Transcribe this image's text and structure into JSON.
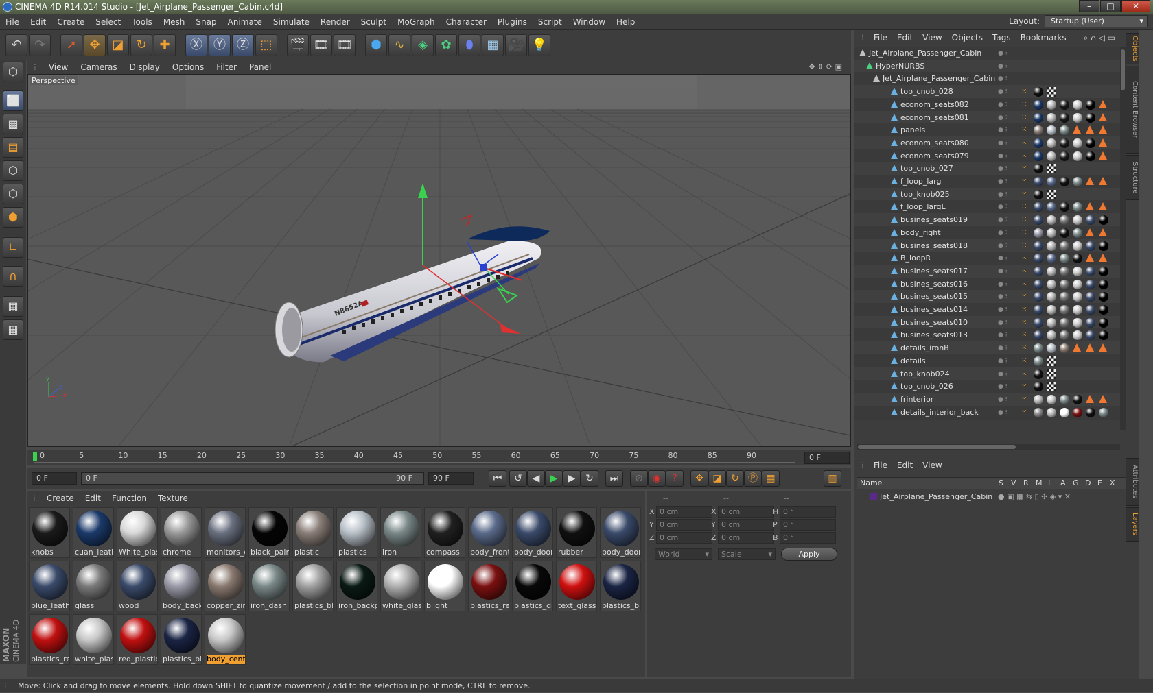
{
  "titlebar": {
    "title": "CINEMA 4D R14.014 Studio - [Jet_Airplane_Passenger_Cabin.c4d]"
  },
  "menu": [
    "File",
    "Edit",
    "Create",
    "Select",
    "Tools",
    "Mesh",
    "Snap",
    "Animate",
    "Simulate",
    "Render",
    "Sculpt",
    "MoGraph",
    "Character",
    "Plugins",
    "Script",
    "Window",
    "Help"
  ],
  "layout": {
    "label": "Layout:",
    "value": "Startup (User)"
  },
  "viewport": {
    "menu": [
      "View",
      "Cameras",
      "Display",
      "Options",
      "Filter",
      "Panel"
    ],
    "label": "Perspective",
    "registration": "N8652A"
  },
  "timeline": {
    "ticks": [
      "0",
      "5",
      "10",
      "15",
      "20",
      "25",
      "30",
      "35",
      "40",
      "45",
      "50",
      "55",
      "60",
      "65",
      "70",
      "75",
      "80",
      "85",
      "90"
    ],
    "frame_field": "0 F",
    "start_field": "0 F",
    "range_start": "0 F",
    "range_end": "90 F",
    "end_field": "90 F"
  },
  "materials": {
    "menu": [
      "Create",
      "Edit",
      "Function",
      "Texture"
    ],
    "items": [
      {
        "name": "knobs",
        "color": "#1a1a1a"
      },
      {
        "name": "cuan_leath",
        "color": "#1b3a6a"
      },
      {
        "name": "White_plas",
        "color": "#d8d8d8"
      },
      {
        "name": "chrome",
        "color": "#9a9a9a"
      },
      {
        "name": "monitors_e",
        "color": "#6a7080"
      },
      {
        "name": "black_pain",
        "color": "#050505"
      },
      {
        "name": "plastic",
        "color": "#8a7e78"
      },
      {
        "name": "plastics",
        "color": "#b8c0c8"
      },
      {
        "name": "iron",
        "color": "#7a8888"
      },
      {
        "name": "compass",
        "color": "#202020"
      },
      {
        "name": "body_front",
        "color": "#5a6a8a"
      },
      {
        "name": "body_door",
        "color": "#3a4a6a"
      },
      {
        "name": "rubber",
        "color": "#101010"
      },
      {
        "name": "body_door",
        "color": "#3a4a6a"
      },
      {
        "name": "blue_leath",
        "color": "#3a4a6a"
      },
      {
        "name": "glass",
        "color": "#7a7a7a"
      },
      {
        "name": "wood",
        "color": "#3a4a6a"
      },
      {
        "name": "body_back",
        "color": "#9a9aa8"
      },
      {
        "name": "copper_zin",
        "color": "#8a7a70"
      },
      {
        "name": "iron_dash",
        "color": "#7a8888"
      },
      {
        "name": "plastics_bl",
        "color": "#a0a0a0"
      },
      {
        "name": "iron_backp",
        "color": "#0a1a14"
      },
      {
        "name": "white_glas",
        "color": "#b0b0b0"
      },
      {
        "name": "blight",
        "color": "#ffffff"
      },
      {
        "name": "plastics_re",
        "color": "#7a1010"
      },
      {
        "name": "plastics_da",
        "color": "#080808"
      },
      {
        "name": "text_glass",
        "color": "#d01010"
      },
      {
        "name": "plastics_bl",
        "color": "#1a2444"
      },
      {
        "name": "plastics_re",
        "color": "#c01010"
      },
      {
        "name": "white_plas",
        "color": "#c8c8c8"
      },
      {
        "name": "red_plastic",
        "color": "#c01010"
      },
      {
        "name": "plastics_bl",
        "color": "#1a2444"
      },
      {
        "name": "body_cente",
        "color": "#c8c8c8",
        "selected": true
      }
    ]
  },
  "coords": {
    "header": [
      "--",
      "--",
      "--"
    ],
    "rows": [
      {
        "a": "X",
        "av": "0 cm",
        "b": "X",
        "bv": "0 cm",
        "c": "H",
        "cv": "0 °"
      },
      {
        "a": "Y",
        "av": "0 cm",
        "b": "Y",
        "bv": "0 cm",
        "c": "P",
        "cv": "0 °"
      },
      {
        "a": "Z",
        "av": "0 cm",
        "b": "Z",
        "bv": "0 cm",
        "c": "B",
        "cv": "0 °"
      }
    ],
    "world": "World",
    "scale": "Scale",
    "apply": "Apply"
  },
  "objects": {
    "menu": [
      "File",
      "Edit",
      "View",
      "Objects",
      "Tags",
      "Bookmarks"
    ],
    "tree": [
      {
        "name": "Jet_Airplane_Passenger_Cabin",
        "indent": 0,
        "tags": []
      },
      {
        "name": "HyperNURBS",
        "indent": 1,
        "tags": []
      },
      {
        "name": "Jet_Airplane_Passenger_Cabin",
        "indent": 2,
        "tags": []
      },
      {
        "name": "top_cnob_028",
        "indent": 3,
        "tags": [
          "#111",
          "chk"
        ]
      },
      {
        "name": "econom_seats082",
        "indent": 3,
        "tags": [
          "#1b3a6a",
          "#bbb",
          "#1a1a1a",
          "#ccc",
          "#000",
          "tri"
        ]
      },
      {
        "name": "econom_seats081",
        "indent": 3,
        "tags": [
          "#1b3a6a",
          "#bbb",
          "#1a1a1a",
          "#ccc",
          "#000",
          "tri"
        ]
      },
      {
        "name": "panels",
        "indent": 3,
        "tags": [
          "#8a7e78",
          "#b8c0c8",
          "#7a8888",
          "tri",
          "tri",
          "tri"
        ]
      },
      {
        "name": "econom_seats080",
        "indent": 3,
        "tags": [
          "#1b3a6a",
          "#bbb",
          "#1a1a1a",
          "#ccc",
          "#000",
          "tri"
        ]
      },
      {
        "name": "econom_seats079",
        "indent": 3,
        "tags": [
          "#1b3a6a",
          "#bbb",
          "#1a1a1a",
          "#ccc",
          "#000",
          "tri"
        ]
      },
      {
        "name": "top_cnob_027",
        "indent": 3,
        "tags": [
          "#111",
          "chk"
        ]
      },
      {
        "name": "f_loop_larg",
        "indent": 3,
        "tags": [
          "#3a4a6a",
          "#5a6a8a",
          "#111",
          "#7a8888",
          "tri",
          "tri"
        ]
      },
      {
        "name": "top_knob025",
        "indent": 3,
        "tags": [
          "#111",
          "chk"
        ]
      },
      {
        "name": "f_loop_largL",
        "indent": 3,
        "tags": [
          "#3a4a6a",
          "#5a6a8a",
          "#111",
          "#7a8888",
          "tri",
          "tri"
        ]
      },
      {
        "name": "busines_seats019",
        "indent": 3,
        "tags": [
          "#3a4a6a",
          "#bbb",
          "#777",
          "#ccc",
          "#3a4a6a",
          "#000"
        ]
      },
      {
        "name": "body_right",
        "indent": 3,
        "tags": [
          "#9a9aa8",
          "#bbb",
          "#111",
          "#7a8888",
          "tri",
          "tri"
        ]
      },
      {
        "name": "busines_seats018",
        "indent": 3,
        "tags": [
          "#3a4a6a",
          "#bbb",
          "#777",
          "#ccc",
          "#3a4a6a",
          "#000"
        ]
      },
      {
        "name": "B_loopR",
        "indent": 3,
        "tags": [
          "#3a4a6a",
          "#5a6a8a",
          "#7a8888",
          "#111",
          "tri",
          "tri"
        ]
      },
      {
        "name": "busines_seats017",
        "indent": 3,
        "tags": [
          "#3a4a6a",
          "#bbb",
          "#777",
          "#ccc",
          "#3a4a6a",
          "#000"
        ]
      },
      {
        "name": "busines_seats016",
        "indent": 3,
        "tags": [
          "#3a4a6a",
          "#bbb",
          "#777",
          "#ccc",
          "#3a4a6a",
          "#000"
        ]
      },
      {
        "name": "busines_seats015",
        "indent": 3,
        "tags": [
          "#3a4a6a",
          "#bbb",
          "#777",
          "#ccc",
          "#3a4a6a",
          "#000"
        ]
      },
      {
        "name": "busines_seats014",
        "indent": 3,
        "tags": [
          "#3a4a6a",
          "#bbb",
          "#777",
          "#ccc",
          "#3a4a6a",
          "#000"
        ]
      },
      {
        "name": "busines_seats010",
        "indent": 3,
        "tags": [
          "#3a4a6a",
          "#bbb",
          "#777",
          "#ccc",
          "#3a4a6a",
          "#000"
        ]
      },
      {
        "name": "busines_seats013",
        "indent": 3,
        "tags": [
          "#3a4a6a",
          "#bbb",
          "#777",
          "#ccc",
          "#3a4a6a",
          "#000"
        ]
      },
      {
        "name": "details_ironB",
        "indent": 3,
        "tags": [
          "#7a8888",
          "#b8c0c8",
          "#8a7a70",
          "tri",
          "tri",
          "tri"
        ]
      },
      {
        "name": "details",
        "indent": 3,
        "tags": [
          "#7a8888",
          "chk"
        ]
      },
      {
        "name": "top_knob024",
        "indent": 3,
        "tags": [
          "#111",
          "chk"
        ]
      },
      {
        "name": "top_cnob_026",
        "indent": 3,
        "tags": [
          "#111",
          "chk"
        ]
      },
      {
        "name": "frinterior",
        "indent": 3,
        "tags": [
          "#bbb",
          "#ccc",
          "#7a8888",
          "#111",
          "tri",
          "tri"
        ]
      },
      {
        "name": "details_interior_back",
        "indent": 3,
        "tags": [
          "#888",
          "#bbb",
          "#fff",
          "#7a1010",
          "#111",
          "#7a8888"
        ]
      }
    ]
  },
  "layers": {
    "menu": [
      "File",
      "Edit",
      "View"
    ],
    "columns": [
      "Name",
      "S",
      "V",
      "R",
      "M",
      "L",
      "A",
      "G",
      "D",
      "E",
      "X"
    ],
    "rows": [
      "Jet_Airplane_Passenger_Cabin"
    ]
  },
  "sidetabs": [
    "Objects",
    "Content Browser",
    "Structure",
    "Attributes",
    "Layers"
  ],
  "status": "Move: Click and drag to move elements. Hold down SHIFT to quantize movement / add to the selection in point mode, CTRL to remove.",
  "brand": [
    "MAXON",
    "CINEMA 4D"
  ]
}
